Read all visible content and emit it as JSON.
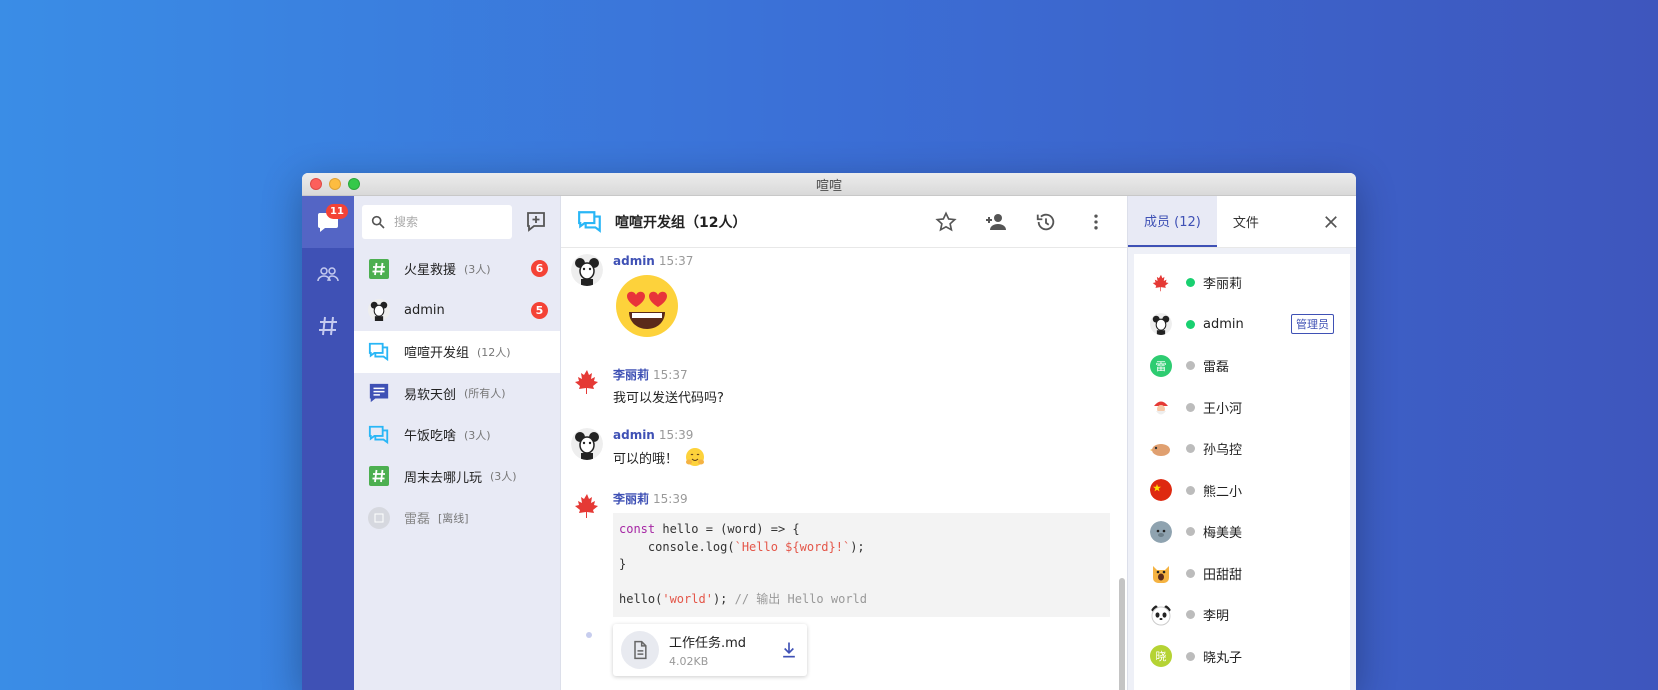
{
  "window": {
    "title": "喧喧"
  },
  "rail": {
    "chat_badge": "11",
    "items": [
      {
        "name": "chat-icon"
      },
      {
        "name": "contacts-icon"
      },
      {
        "name": "channel-hash-icon"
      }
    ]
  },
  "chatlist": {
    "search_placeholder": "搜索",
    "items": [
      {
        "name": "火星救援",
        "count": "(3人)",
        "badge": "6",
        "icon": "hash-green"
      },
      {
        "name": "admin",
        "count": "",
        "badge": "5",
        "icon": "avatar-mouse"
      },
      {
        "name": "喧喧开发组",
        "count": "(12人)",
        "badge": "",
        "icon": "group-chat"
      },
      {
        "name": "易软天创",
        "count": "(所有人)",
        "badge": "",
        "icon": "notice"
      },
      {
        "name": "午饭吃啥",
        "count": "(3人)",
        "badge": "",
        "icon": "group-chat"
      },
      {
        "name": "周末去哪儿玩",
        "count": "(3人)",
        "badge": "",
        "icon": "hash-green"
      },
      {
        "name": "雷磊",
        "count": "[离线]",
        "badge": "",
        "icon": "avatar-gray"
      }
    ]
  },
  "main": {
    "title": "喧喧开发组（12人）",
    "messages": [
      {
        "sender": "admin",
        "time": "15:37",
        "content": ""
      },
      {
        "sender": "李丽莉",
        "time": "15:37",
        "content": "我可以发送代码吗?"
      },
      {
        "sender": "admin",
        "time": "15:39",
        "content": "可以的哦！"
      },
      {
        "sender": "李丽莉",
        "time": "15:39",
        "content": ""
      }
    ],
    "code": {
      "line1_kw": "const",
      "line1_rest": " hello = (word) => {",
      "line2_pre": "    console.log(",
      "line2_str": "`Hello ${word}!`",
      "line2_post": ");",
      "line3": "}",
      "line5_pre": "hello(",
      "line5_str": "'world'",
      "line5_post": "); ",
      "line5_cmt": "// 输出 Hello world"
    },
    "file": {
      "name": "工作任务.md",
      "size": "4.02KB"
    }
  },
  "rpanel": {
    "tab_members": "成员 (12)",
    "tab_files": "文件",
    "members": [
      {
        "name": "李丽莉",
        "status": "online",
        "tag": "",
        "avatar": "maple",
        "color": "#fff"
      },
      {
        "name": "admin",
        "status": "online",
        "tag": "管理员",
        "avatar": "mouse",
        "color": "#fff"
      },
      {
        "name": "雷磊",
        "status": "offline",
        "tag": "",
        "avatar": "雷",
        "color": "#2ecc71"
      },
      {
        "name": "王小河",
        "status": "offline",
        "tag": "",
        "avatar": "santa",
        "color": "#fff"
      },
      {
        "name": "孙乌控",
        "status": "offline",
        "tag": "",
        "avatar": "bird",
        "color": "#fff"
      },
      {
        "name": "熊二小",
        "status": "offline",
        "tag": "",
        "avatar": "flag-cn",
        "color": "#de2910"
      },
      {
        "name": "梅美美",
        "status": "offline",
        "tag": "",
        "avatar": "seal",
        "color": "#8fa3b0"
      },
      {
        "name": "田甜甜",
        "status": "offline",
        "tag": "",
        "avatar": "cat",
        "color": "#f5b342"
      },
      {
        "name": "李明",
        "status": "offline",
        "tag": "",
        "avatar": "panda",
        "color": "#fff"
      },
      {
        "name": "晓丸子",
        "status": "offline",
        "tag": "",
        "avatar": "晓",
        "color": "#b5d334"
      }
    ]
  },
  "colors": {
    "accent": "#3f51b5",
    "badge": "#f44336",
    "online": "#19d070"
  }
}
